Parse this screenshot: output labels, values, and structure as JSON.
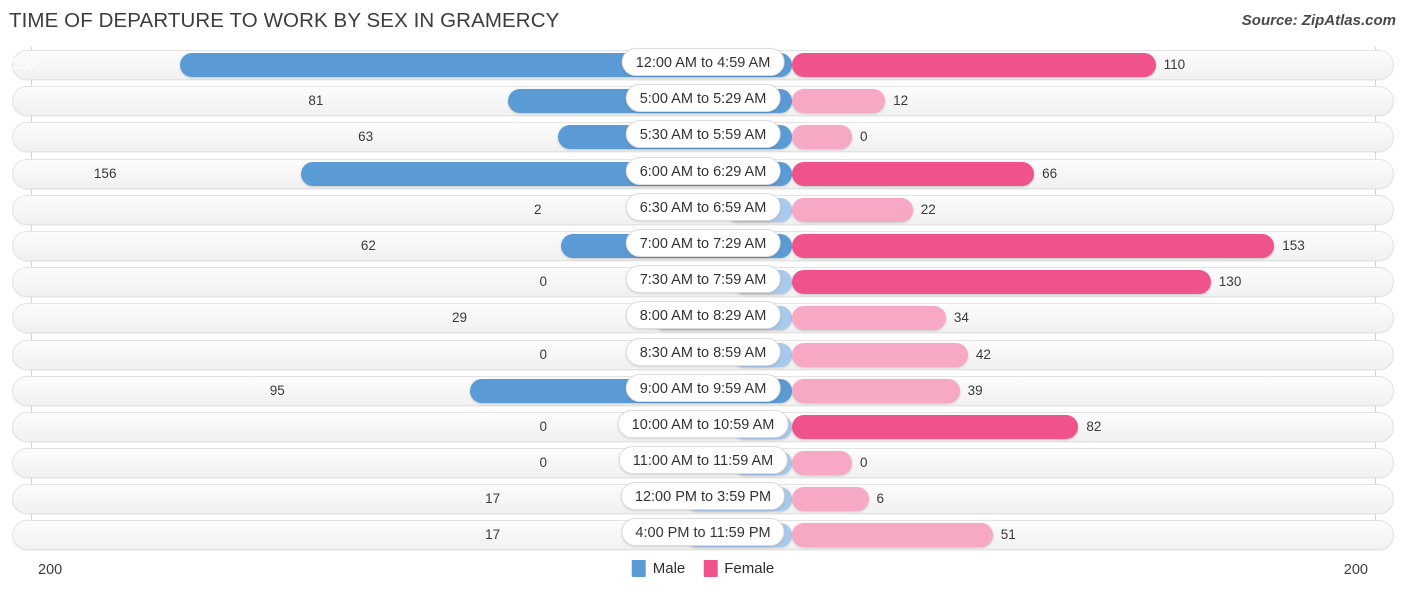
{
  "header": {
    "title": "TIME OF DEPARTURE TO WORK BY SEX IN GRAMERCY",
    "source": "Source: ZipAtlas.com"
  },
  "footer": {
    "axis_left": "200",
    "axis_right": "200"
  },
  "legend": {
    "items": [
      {
        "label": "Male",
        "color": "#5b9bd5"
      },
      {
        "label": "Female",
        "color": "#f0528c"
      }
    ]
  },
  "colors": {
    "male_high": "#5b9bd5",
    "male_low": "#a9c9ec",
    "female_high": "#f0528c",
    "female_low": "#f7a8c4",
    "track": "#f4f4f4",
    "axis": "#d6d6d6"
  },
  "chart_data": {
    "type": "bar",
    "subtype": "diverging-bidirectional-bar",
    "title": "TIME OF DEPARTURE TO WORK BY SEX IN GRAMERCY",
    "source": "Source: ZipAtlas.com",
    "xlabel": "",
    "ylabel": "",
    "xlim": [
      200,
      200
    ],
    "axis_left_max": 200,
    "axis_right_max": 200,
    "grid": false,
    "legend_position": "bottom-center",
    "categories": [
      "12:00 AM to 4:59 AM",
      "5:00 AM to 5:29 AM",
      "5:30 AM to 5:59 AM",
      "6:00 AM to 6:29 AM",
      "6:30 AM to 6:59 AM",
      "7:00 AM to 7:29 AM",
      "7:30 AM to 7:59 AM",
      "8:00 AM to 8:29 AM",
      "8:30 AM to 8:59 AM",
      "9:00 AM to 9:59 AM",
      "10:00 AM to 10:59 AM",
      "11:00 AM to 11:59 AM",
      "12:00 PM to 3:59 PM",
      "4:00 PM to 11:59 PM"
    ],
    "series": [
      {
        "name": "Male",
        "direction": "left",
        "color": "#5b9bd5",
        "values": [
          200,
          81,
          63,
          156,
          2,
          62,
          0,
          29,
          0,
          95,
          0,
          0,
          17,
          17
        ]
      },
      {
        "name": "Female",
        "direction": "right",
        "color": "#f0528c",
        "values": [
          110,
          12,
          0,
          66,
          22,
          153,
          130,
          34,
          42,
          39,
          82,
          0,
          6,
          51
        ]
      }
    ]
  }
}
